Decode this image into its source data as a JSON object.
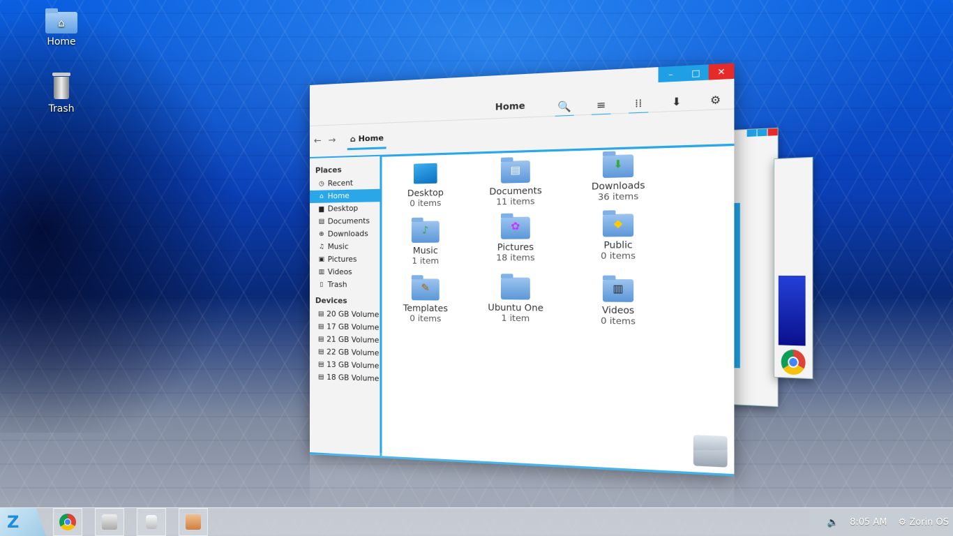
{
  "desktop": {
    "icons": [
      {
        "label": "Home"
      },
      {
        "label": "Trash"
      }
    ]
  },
  "window": {
    "title": "Home",
    "controls": {
      "minimize": "–",
      "maximize": "□",
      "close": "✕"
    },
    "toolbar": {
      "search": "🔍",
      "list_view": "≡",
      "grid_view": "⁞⁞",
      "download": "⬇",
      "settings": "⚙"
    },
    "nav": {
      "back": "←",
      "forward": "→"
    },
    "breadcrumb": "Home",
    "sidebar": {
      "places_heading": "Places",
      "places": [
        "Recent",
        "Home",
        "Desktop",
        "Documents",
        "Downloads",
        "Music",
        "Pictures",
        "Videos",
        "Trash"
      ],
      "devices_heading": "Devices",
      "devices": [
        "20 GB Volume",
        "17 GB Volume",
        "21 GB Volume",
        "22 GB Volume",
        "13 GB Volume",
        "18 GB Volume"
      ]
    },
    "files": [
      {
        "name": "Desktop",
        "count": "0 items"
      },
      {
        "name": "Documents",
        "count": "11 items"
      },
      {
        "name": "Downloads",
        "count": "36 items"
      },
      {
        "name": "Music",
        "count": "1 item"
      },
      {
        "name": "Pictures",
        "count": "18 items"
      },
      {
        "name": "Public",
        "count": "0 items"
      },
      {
        "name": "Templates",
        "count": "0 items"
      },
      {
        "name": "Ubuntu One",
        "count": "1 item"
      },
      {
        "name": "Videos",
        "count": "0 items"
      }
    ]
  },
  "taskbar": {
    "time": "8:05 AM",
    "os_label": "Zorin OS"
  },
  "colors": {
    "accent": "#29a7e8",
    "close": "#e52a2a"
  }
}
